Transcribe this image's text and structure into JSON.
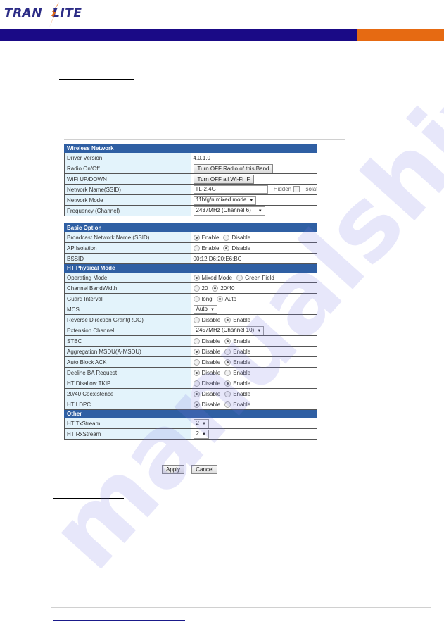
{
  "brand": {
    "logo_text_left": "TRAN",
    "logo_text_right": "LITE",
    "band_color": "#1a0a86",
    "accent_color": "#e66a12"
  },
  "watermark": "manualshive",
  "wireless_network": {
    "title": "Wireless Network",
    "driver_version": {
      "label": "Driver Version",
      "value": "4.0.1.0"
    },
    "radio": {
      "label": "Radio On/Off",
      "button": "Turn OFF Radio of this Band"
    },
    "wifi_updown": {
      "label": "WiFi UP/DOWN",
      "button": "Turn OFF all Wi-Fi IF"
    },
    "ssid": {
      "label": "Network Name(SSID)",
      "value": "TL-2.4G",
      "hidden_label": "Hidden",
      "isolated_label": "Isolated"
    },
    "network_mode": {
      "label": "Network Mode",
      "value": "11b/g/n mixed mode"
    },
    "frequency": {
      "label": "Frequency (Channel)",
      "value": "2437MHz (Channel 6)"
    }
  },
  "basic_option": {
    "title": "Basic Option",
    "broadcast": {
      "label": "Broadcast Network Name (SSID)",
      "options": [
        "Enable",
        "Disable"
      ],
      "selected": "Enable"
    },
    "ap_isolation": {
      "label": "AP Isolation",
      "options": [
        "Enable",
        "Disable"
      ],
      "selected": "Disable"
    },
    "bssid": {
      "label": "BSSID",
      "value": "00:12:D6:20:E6:BC"
    }
  },
  "ht_physical_mode": {
    "title": "HT Physical Mode",
    "operating_mode": {
      "label": "Operating Mode",
      "options": [
        "Mixed Mode",
        "Green Field"
      ],
      "selected": "Mixed Mode"
    },
    "bandwidth": {
      "label": "Channel BandWidth",
      "options": [
        "20",
        "20/40"
      ],
      "selected": "20/40"
    },
    "guard_interval": {
      "label": "Guard Interval",
      "options": [
        "long",
        "Auto"
      ],
      "selected": "Auto"
    },
    "mcs": {
      "label": "MCS",
      "value": "Auto"
    },
    "rdg": {
      "label": "Reverse Direction Grant(RDG)",
      "options": [
        "Disable",
        "Enable"
      ],
      "selected": "Enable"
    },
    "extension_channel": {
      "label": "Extension Channel",
      "value": "2457MHz (Channel 10)"
    },
    "stbc": {
      "label": "STBC",
      "options": [
        "Disable",
        "Enable"
      ],
      "selected": "Enable"
    },
    "amsdu": {
      "label": "Aggregation MSDU(A-MSDU)",
      "options": [
        "Disable",
        "Enable"
      ],
      "selected": "Disable"
    },
    "auto_block_ack": {
      "label": "Auto Block ACK",
      "options": [
        "Disable",
        "Enable"
      ],
      "selected": "Enable"
    },
    "decline_ba": {
      "label": "Decline BA Request",
      "options": [
        "Disable",
        "Enable"
      ],
      "selected": "Disable"
    },
    "disallow_tkip": {
      "label": "HT Disallow TKIP",
      "options": [
        "Disable",
        "Enable"
      ],
      "selected": "Enable"
    },
    "coexistence": {
      "label": "20/40 Coexistence",
      "options": [
        "Disable",
        "Enable"
      ],
      "selected": "Disable"
    },
    "ldpc": {
      "label": "HT LDPC",
      "options": [
        "Disable",
        "Enable"
      ],
      "selected": "Disable"
    }
  },
  "other": {
    "title": "Other",
    "tx_stream": {
      "label": "HT TxStream",
      "value": "2"
    },
    "rx_stream": {
      "label": "HT RxStream",
      "value": "2"
    }
  },
  "actions": {
    "apply": "Apply",
    "cancel": "Cancel"
  }
}
